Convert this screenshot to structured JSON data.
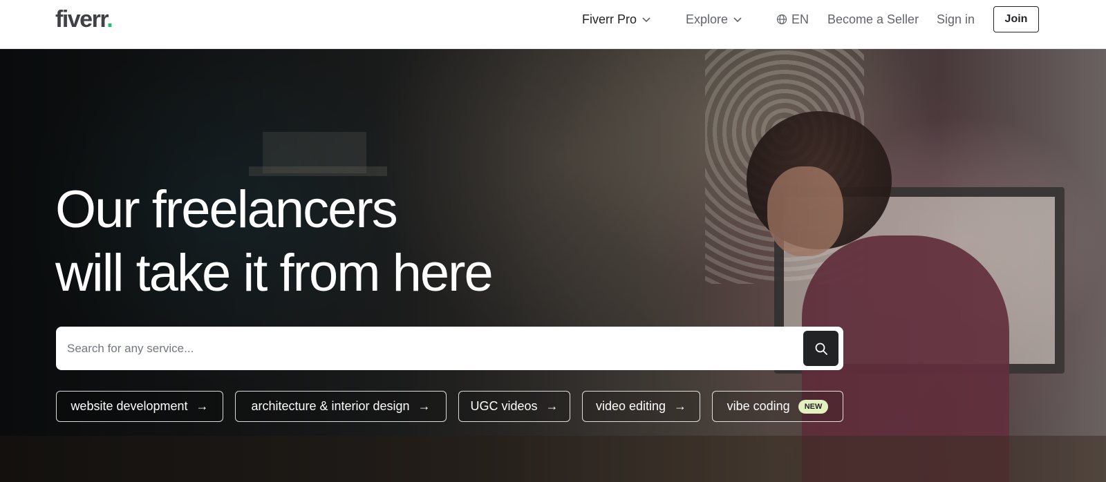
{
  "header": {
    "logo_text": "fiverr",
    "logo_dot": ".",
    "nav": {
      "fiverr_pro": "Fiverr Pro",
      "explore": "Explore",
      "language": "EN",
      "become_seller": "Become a Seller",
      "sign_in": "Sign in",
      "join": "Join"
    }
  },
  "hero": {
    "headline_line1": "Our freelancers",
    "headline_line2": "will take it from here"
  },
  "search": {
    "placeholder": "Search for any service..."
  },
  "pills": [
    {
      "label": "website development",
      "arrow": "→"
    },
    {
      "label": "architecture & interior design",
      "arrow": "→"
    },
    {
      "label": "UGC videos",
      "arrow": "→"
    },
    {
      "label": "video editing",
      "arrow": "→"
    },
    {
      "label": "vibe coding",
      "badge": "NEW"
    }
  ],
  "colors": {
    "brand_green": "#1dbf73",
    "text_dark": "#222325",
    "text_gray": "#62646a",
    "new_badge_bg": "#e5f0c0"
  },
  "icons": {
    "fiverr_pro_dropdown": "chevron-down-icon",
    "explore_dropdown": "chevron-down-icon",
    "language": "globe-icon",
    "search": "search-icon",
    "pill_arrow": "arrow-right-icon"
  }
}
